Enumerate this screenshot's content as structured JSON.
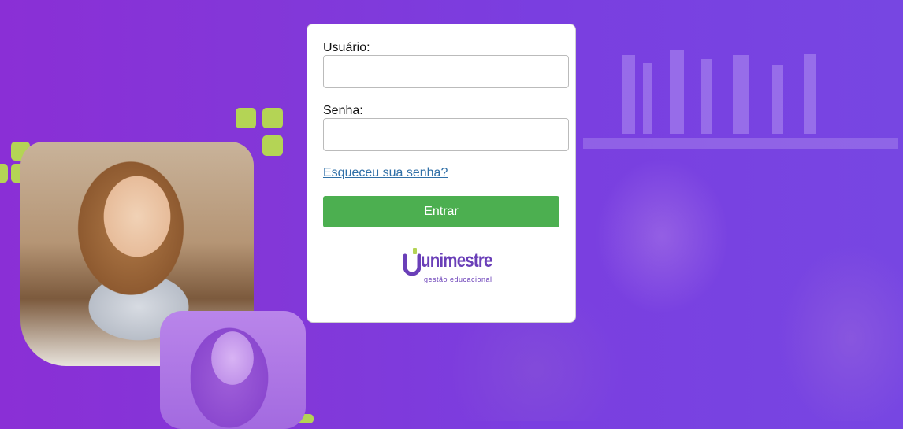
{
  "login": {
    "username_label": "Usuário:",
    "username_value": "",
    "password_label": "Senha:",
    "password_value": "",
    "forgot_link": "Esqueceu sua senha?",
    "submit_label": "Entrar"
  },
  "logo": {
    "wordmark": "unimestre",
    "tagline": "gestão educacional"
  },
  "colors": {
    "background_purple": "#8a2fd6",
    "accent_green": "#b4d455",
    "button_green": "#4caf50",
    "link_blue": "#2f6fa7",
    "logo_purple": "#6a3fb8"
  }
}
